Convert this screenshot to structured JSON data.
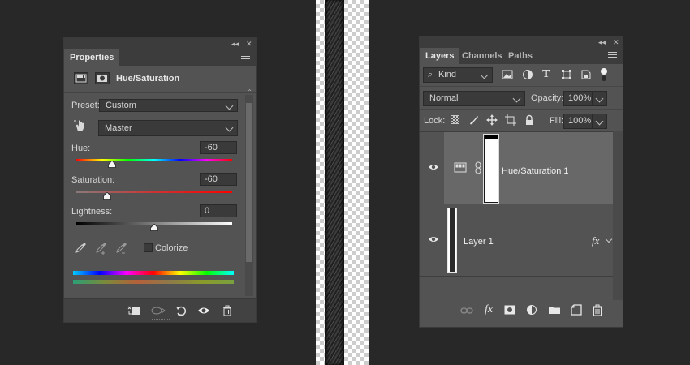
{
  "properties": {
    "tab_label": "Properties",
    "title": "Hue/Saturation",
    "preset_label": "Preset:",
    "preset_value": "Custom",
    "channel_value": "Master",
    "hue_label": "Hue:",
    "hue_value": "-60",
    "saturation_label": "Saturation:",
    "saturation_value": "-60",
    "lightness_label": "Lightness:",
    "lightness_value": "0",
    "colorize_label": "Colorize",
    "hue_fraction": 0.23,
    "saturation_fraction": 0.2,
    "lightness_fraction": 0.5
  },
  "layers_panel": {
    "tabs": [
      "Layers",
      "Channels",
      "Paths"
    ],
    "kind_label": "Kind",
    "blend_mode": "Normal",
    "opacity_label": "Opacity:",
    "opacity_value": "100%",
    "lock_label": "Lock:",
    "fill_label": "Fill:",
    "fill_value": "100%",
    "layers": [
      {
        "name": "Hue/Saturation 1",
        "selected": true
      },
      {
        "name": "Layer 1",
        "selected": false,
        "fx": "fx"
      }
    ]
  },
  "colors": {
    "panel_bg": "#535353",
    "app_bg": "#282828",
    "selected_layer": "#686868"
  },
  "icons": {
    "window_close": "✕",
    "collapse": "◂◂"
  }
}
